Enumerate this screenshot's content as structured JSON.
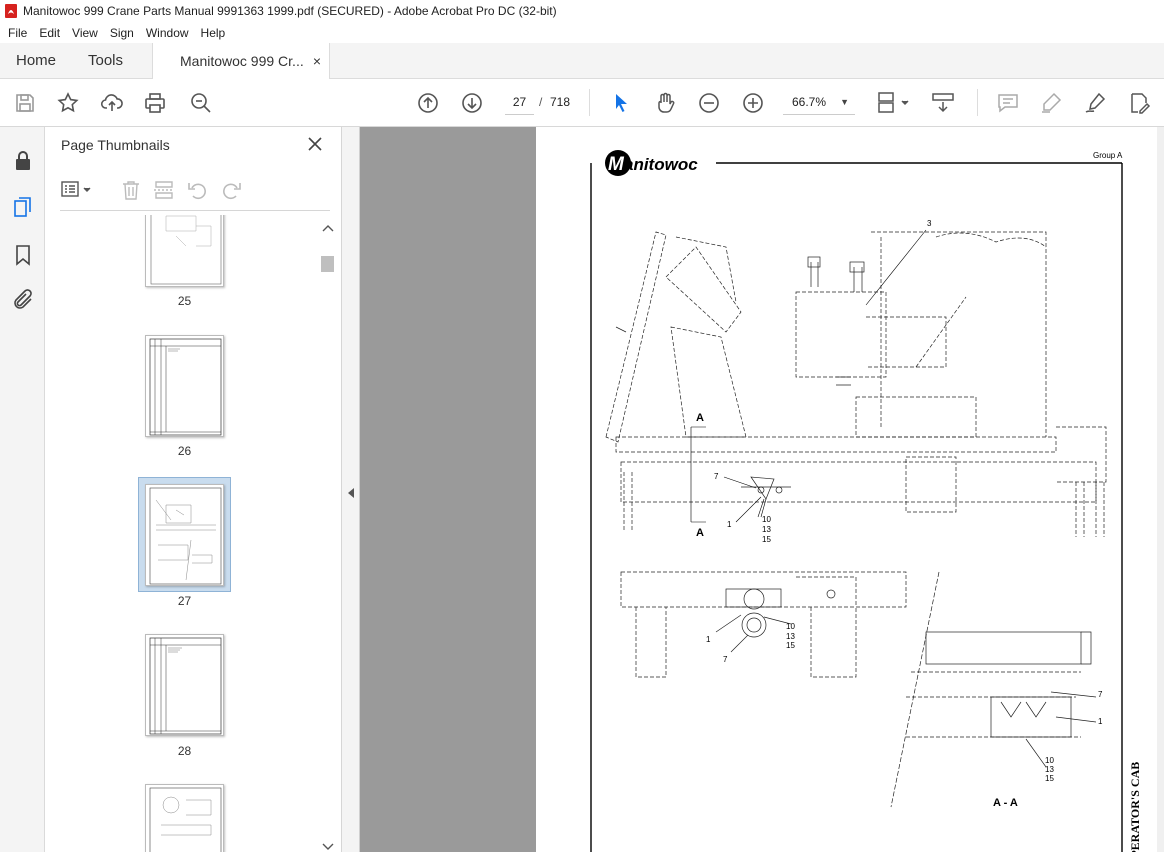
{
  "window": {
    "title": "Manitowoc 999 Crane Parts Manual 9991363 1999.pdf (SECURED) - Adobe Acrobat Pro DC (32-bit)"
  },
  "menu": [
    "File",
    "Edit",
    "View",
    "Sign",
    "Window",
    "Help"
  ],
  "tabs": {
    "home": "Home",
    "tools": "Tools",
    "document": "Manitowoc 999 Cr...",
    "close": "×"
  },
  "toolbar": {
    "current_page": "27",
    "page_separator": "/",
    "total_pages": "718",
    "zoom": "66.7%",
    "icons": [
      "save-icon",
      "bookmark-star-icon",
      "upload-icon",
      "print-icon",
      "zoom-search-icon",
      "page-up-icon",
      "page-down-icon",
      "select-cursor-icon",
      "hand-icon",
      "zoom-out-icon",
      "zoom-in-icon",
      "page-fit-icon",
      "scroll-mode-icon",
      "comment-icon",
      "highlight-icon",
      "sign-icon",
      "edit-icon"
    ]
  },
  "sidebar": {
    "title": "Page Thumbnails",
    "thumbnails": [
      {
        "label": "25"
      },
      {
        "label": "26"
      },
      {
        "label": "27",
        "selected": true
      },
      {
        "label": "28"
      }
    ]
  },
  "document_page": {
    "brand": "Manitowoc",
    "group": "Group A",
    "callouts": [
      "3",
      "7",
      "1",
      "10",
      "13",
      "15",
      "A",
      "A",
      "1",
      "7",
      "10",
      "13",
      "15",
      "7",
      "1",
      "10",
      "13",
      "15"
    ],
    "section_label": "A - A",
    "side_title": "OPERATOR'S CAB"
  }
}
